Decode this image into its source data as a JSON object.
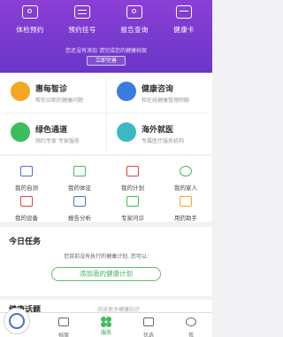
{
  "top_nav": {
    "items": [
      {
        "label": "体检预约",
        "icon": "calendar-clock-icon"
      },
      {
        "label": "预约挂号",
        "icon": "register-card-icon"
      },
      {
        "label": "报告查询",
        "icon": "report-search-icon"
      },
      {
        "label": "健康卡",
        "icon": "health-card-icon"
      }
    ]
  },
  "notice": {
    "text": "您还没有添加  请完成您的健康档案",
    "link_label": "立即完善"
  },
  "services": [
    {
      "title": "惠每智诊",
      "subtitle": "帮你诊断的健康问题",
      "color": "#f5a623",
      "icon": "smart-diagnosis-icon"
    },
    {
      "title": "健康咨询",
      "subtitle": "和在线健康管理师聊",
      "color": "#3b7be0",
      "icon": "health-consult-icon"
    },
    {
      "title": "绿色通道",
      "subtitle": "预约专家 专家服务",
      "color": "#3dbd5b",
      "icon": "green-channel-icon"
    },
    {
      "title": "海外就医",
      "subtitle": "专属医疗服务机构",
      "color": "#3cb8c4",
      "icon": "overseas-care-icon"
    }
  ],
  "grid": {
    "items": [
      {
        "label": "我的自测",
        "icon": "self-test-icon"
      },
      {
        "label": "我的体征",
        "icon": "vital-signs-icon"
      },
      {
        "label": "我的计划",
        "icon": "my-plan-icon"
      },
      {
        "label": "我的家人",
        "icon": "family-icon"
      },
      {
        "label": "我的设备",
        "icon": "device-icon"
      },
      {
        "label": "报告分析",
        "icon": "report-analysis-icon"
      },
      {
        "label": "专家问诊",
        "icon": "expert-consult-icon"
      },
      {
        "label": "用药助手",
        "icon": "medication-icon"
      }
    ]
  },
  "today_task": {
    "title": "今日任务",
    "description": "您目前没有执行的健康计划, 您可以:",
    "button_label": "添加我的健康计划"
  },
  "health_section": {
    "title": "健康话题",
    "text": "阅读更多健康知识"
  },
  "tabbar": {
    "items": [
      {
        "label": "",
        "icon": "profile-icon"
      },
      {
        "label": "档案",
        "icon": "archive-icon"
      },
      {
        "label": "服务",
        "icon": "service-icon"
      },
      {
        "label": "优选",
        "icon": "select-icon"
      },
      {
        "label": "我",
        "icon": "me-icon"
      }
    ]
  },
  "colors": {
    "header": "#7b3bd0",
    "accent_green": "#3dbd5b",
    "icon_blue": "#4a6fd4"
  }
}
